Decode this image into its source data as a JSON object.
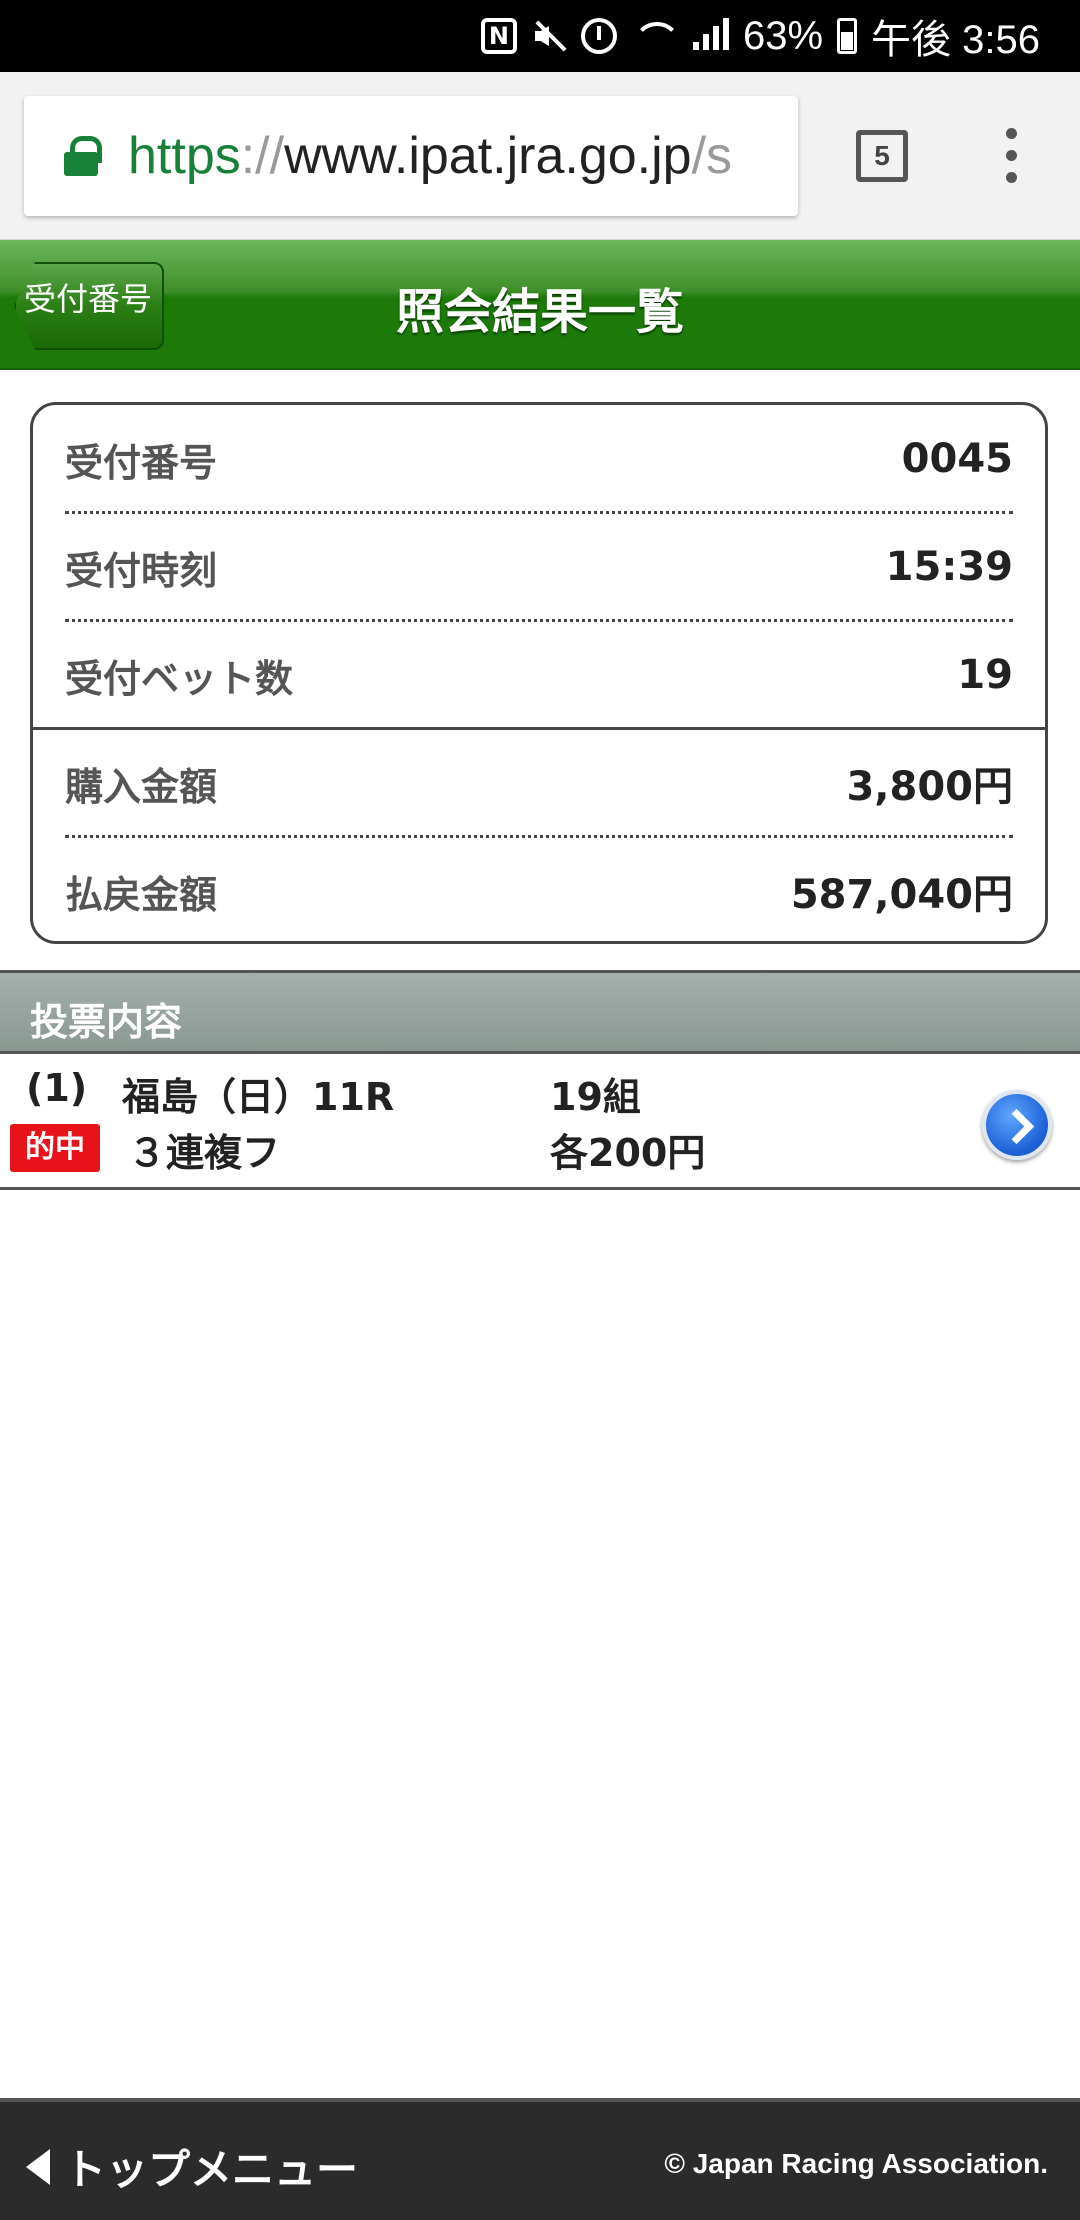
{
  "status_bar": {
    "battery": "63%",
    "time": "午後 3:56",
    "icons": [
      "nfc-icon",
      "mute-icon",
      "alarm-icon",
      "wifi-icon",
      "signal-icon",
      "battery-icon"
    ]
  },
  "browser": {
    "url_protocol": "https",
    "url_sep": "://",
    "url_host": "www.ipat.jra.go.jp",
    "url_rest": "/s",
    "tab_count": "5"
  },
  "header": {
    "back_label": "受付番号",
    "title": "照会結果一覧"
  },
  "summary": {
    "rows": [
      {
        "label": "受付番号",
        "value": "0045"
      },
      {
        "label": "受付時刻",
        "value": "15:39"
      },
      {
        "label": "受付ベット数",
        "value": "19"
      },
      {
        "label": "購入金額",
        "value": "3,800円"
      },
      {
        "label": "払戻金額",
        "value": "587,040円"
      }
    ]
  },
  "section": {
    "title": "投票内容"
  },
  "ticket": {
    "index": "(1)",
    "race": "福島（日）11R",
    "combos": "19組",
    "badge": "的中",
    "bet_type": "３連複フ",
    "amount": "各200円"
  },
  "footer": {
    "top_menu": "トップメニュー",
    "copyright": "© Japan Racing Association."
  },
  "colors": {
    "header_green": "#1d7a08",
    "hit_red": "#e8131a",
    "lock_green": "#188038",
    "footer_bg": "#2b2b2b"
  }
}
